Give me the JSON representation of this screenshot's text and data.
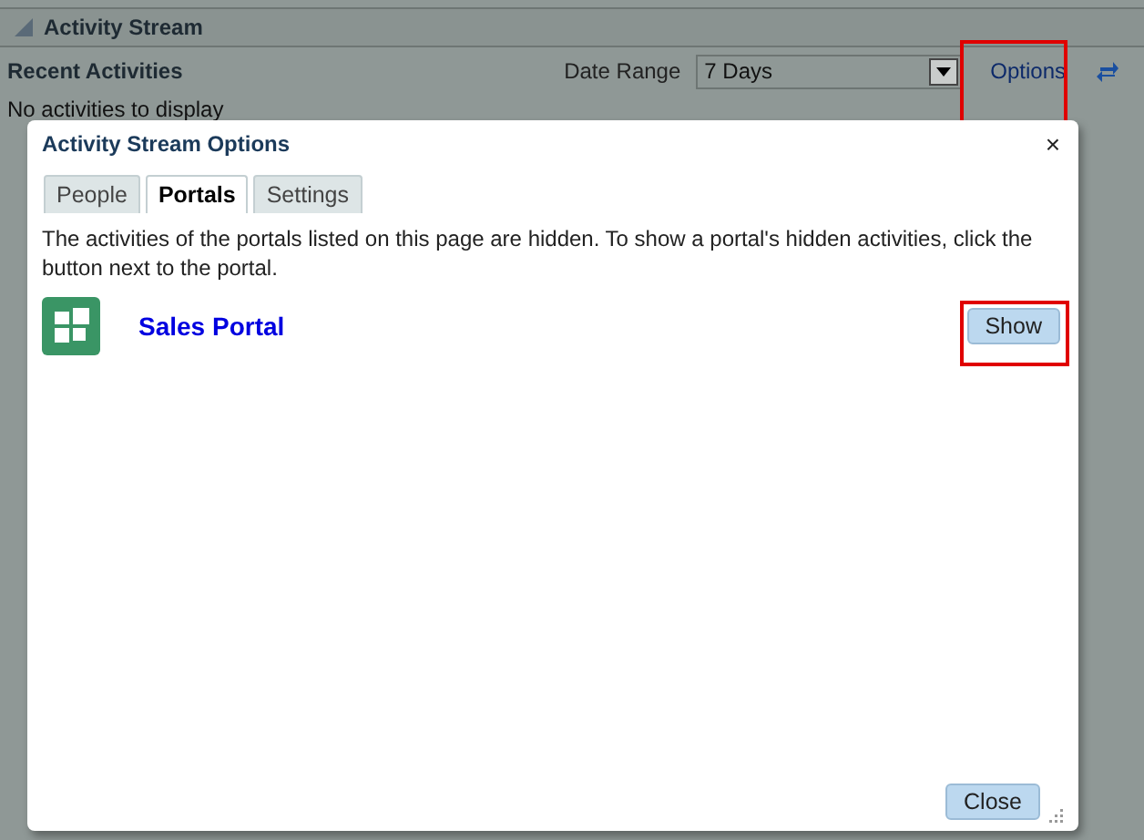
{
  "panel": {
    "title": "Activity Stream",
    "expanded": true
  },
  "toolbar": {
    "heading": "Recent Activities",
    "date_range_label": "Date Range",
    "date_range_value": "7 Days",
    "options_link": "Options",
    "options_highlighted": true
  },
  "empty_message": "No activities to display",
  "dialog": {
    "title": "Activity Stream Options",
    "close_glyph": "×",
    "tabs": [
      {
        "label": "People",
        "selected": false
      },
      {
        "label": "Portals",
        "selected": true
      },
      {
        "label": "Settings",
        "selected": false
      }
    ],
    "description": "The activities of the portals listed on this page are hidden. To show a portal's hidden activities, click the button next to the portal.",
    "portals": [
      {
        "name": "Sales Portal",
        "button": "Show",
        "highlighted": true
      }
    ],
    "close_button": "Close"
  }
}
